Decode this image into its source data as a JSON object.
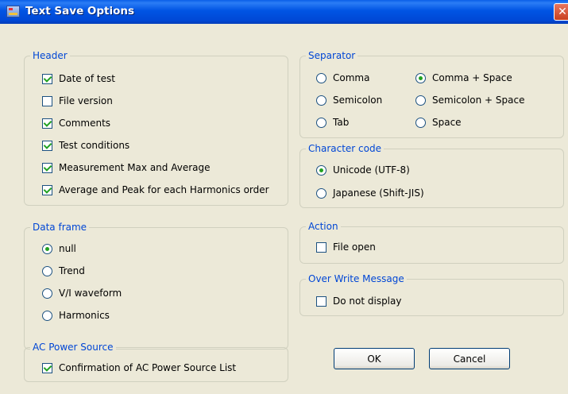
{
  "window": {
    "title": "Text Save Options",
    "close_symbol": "✕"
  },
  "header_group": {
    "title": "Header",
    "items": [
      {
        "label": "Date of test",
        "checked": true
      },
      {
        "label": "File version",
        "checked": false
      },
      {
        "label": "Comments",
        "checked": true
      },
      {
        "label": "Test conditions",
        "checked": true
      },
      {
        "label": "Measurement Max and Average",
        "checked": true
      },
      {
        "label": "Average and Peak for each Harmonics order",
        "checked": true
      }
    ]
  },
  "data_frame": {
    "title": "Data frame",
    "options": [
      {
        "label": "null",
        "selected": true
      },
      {
        "label": "Trend",
        "selected": false
      },
      {
        "label": "V/I waveform",
        "selected": false
      },
      {
        "label": "Harmonics",
        "selected": false
      }
    ]
  },
  "ac_power_source": {
    "title": "AC Power Source",
    "items": [
      {
        "label": "Confirmation of AC Power Source List",
        "checked": true
      }
    ]
  },
  "separator": {
    "title": "Separator",
    "options": [
      {
        "label": "Comma",
        "selected": false
      },
      {
        "label": "Comma + Space",
        "selected": true
      },
      {
        "label": "Semicolon",
        "selected": false
      },
      {
        "label": "Semicolon + Space",
        "selected": false
      },
      {
        "label": "Tab",
        "selected": false
      },
      {
        "label": "Space",
        "selected": false
      }
    ]
  },
  "character_code": {
    "title": "Character code",
    "options": [
      {
        "label": "Unicode (UTF-8)",
        "selected": true
      },
      {
        "label": "Japanese (Shift-JIS)",
        "selected": false
      }
    ]
  },
  "action": {
    "title": "Action",
    "items": [
      {
        "label": "File open",
        "checked": false
      }
    ]
  },
  "over_write": {
    "title": "Over Write Message",
    "items": [
      {
        "label": "Do not display",
        "checked": false
      }
    ]
  },
  "buttons": {
    "ok": "OK",
    "cancel": "Cancel"
  },
  "colors": {
    "titlebar": "#0054e3",
    "group_title": "#0046d5",
    "check_mark": "#21a121",
    "dialog_bg": "#ece9d8"
  }
}
